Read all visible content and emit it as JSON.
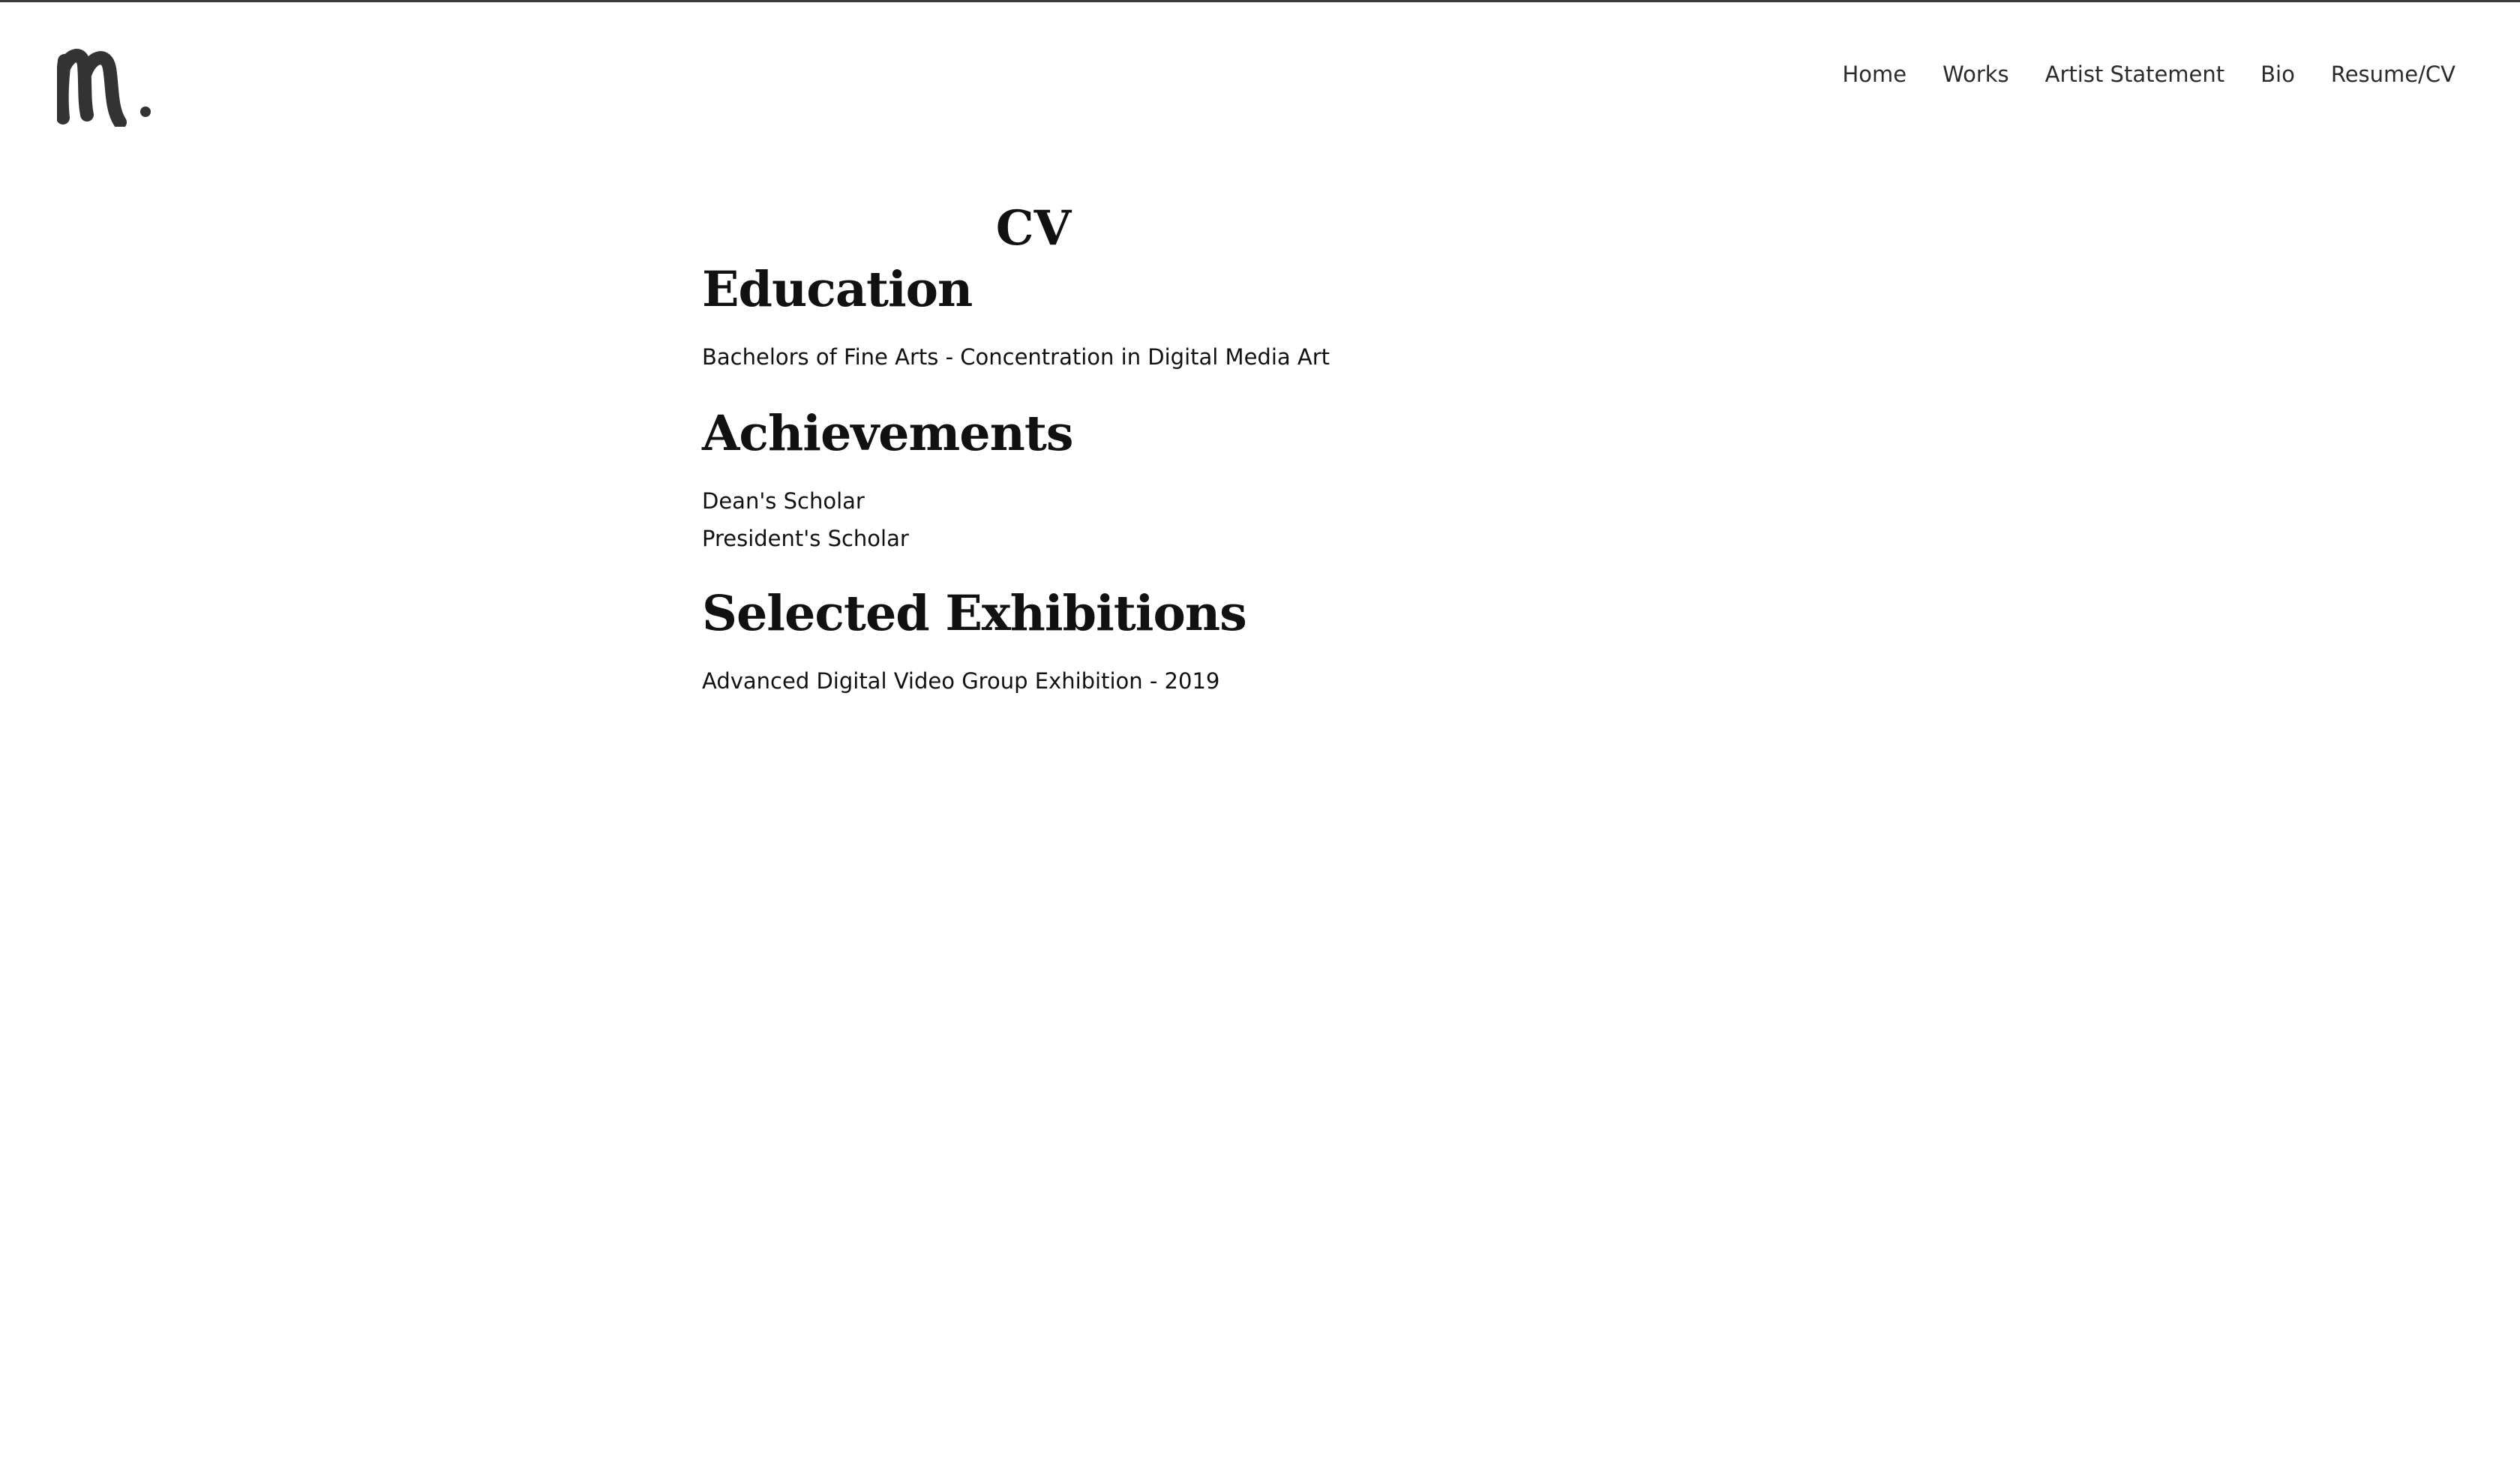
{
  "logo": {
    "icon": "script-m-logo-icon",
    "color": "#333333"
  },
  "nav": {
    "items": [
      {
        "label": "Home"
      },
      {
        "label": "Works"
      },
      {
        "label": "Artist Statement"
      },
      {
        "label": "Bio"
      },
      {
        "label": "Resume/CV"
      }
    ]
  },
  "page": {
    "title": "CV",
    "sections": [
      {
        "heading": "Education",
        "entries": [
          "Bachelors of Fine Arts - Concentration in Digital Media Art"
        ]
      },
      {
        "heading": "Achievements",
        "entries": [
          "Dean's Scholar",
          "President's Scholar"
        ]
      },
      {
        "heading": "Selected Exhibitions",
        "entries": [
          "Advanced Digital Video Group Exhibition - 2019"
        ]
      }
    ]
  }
}
